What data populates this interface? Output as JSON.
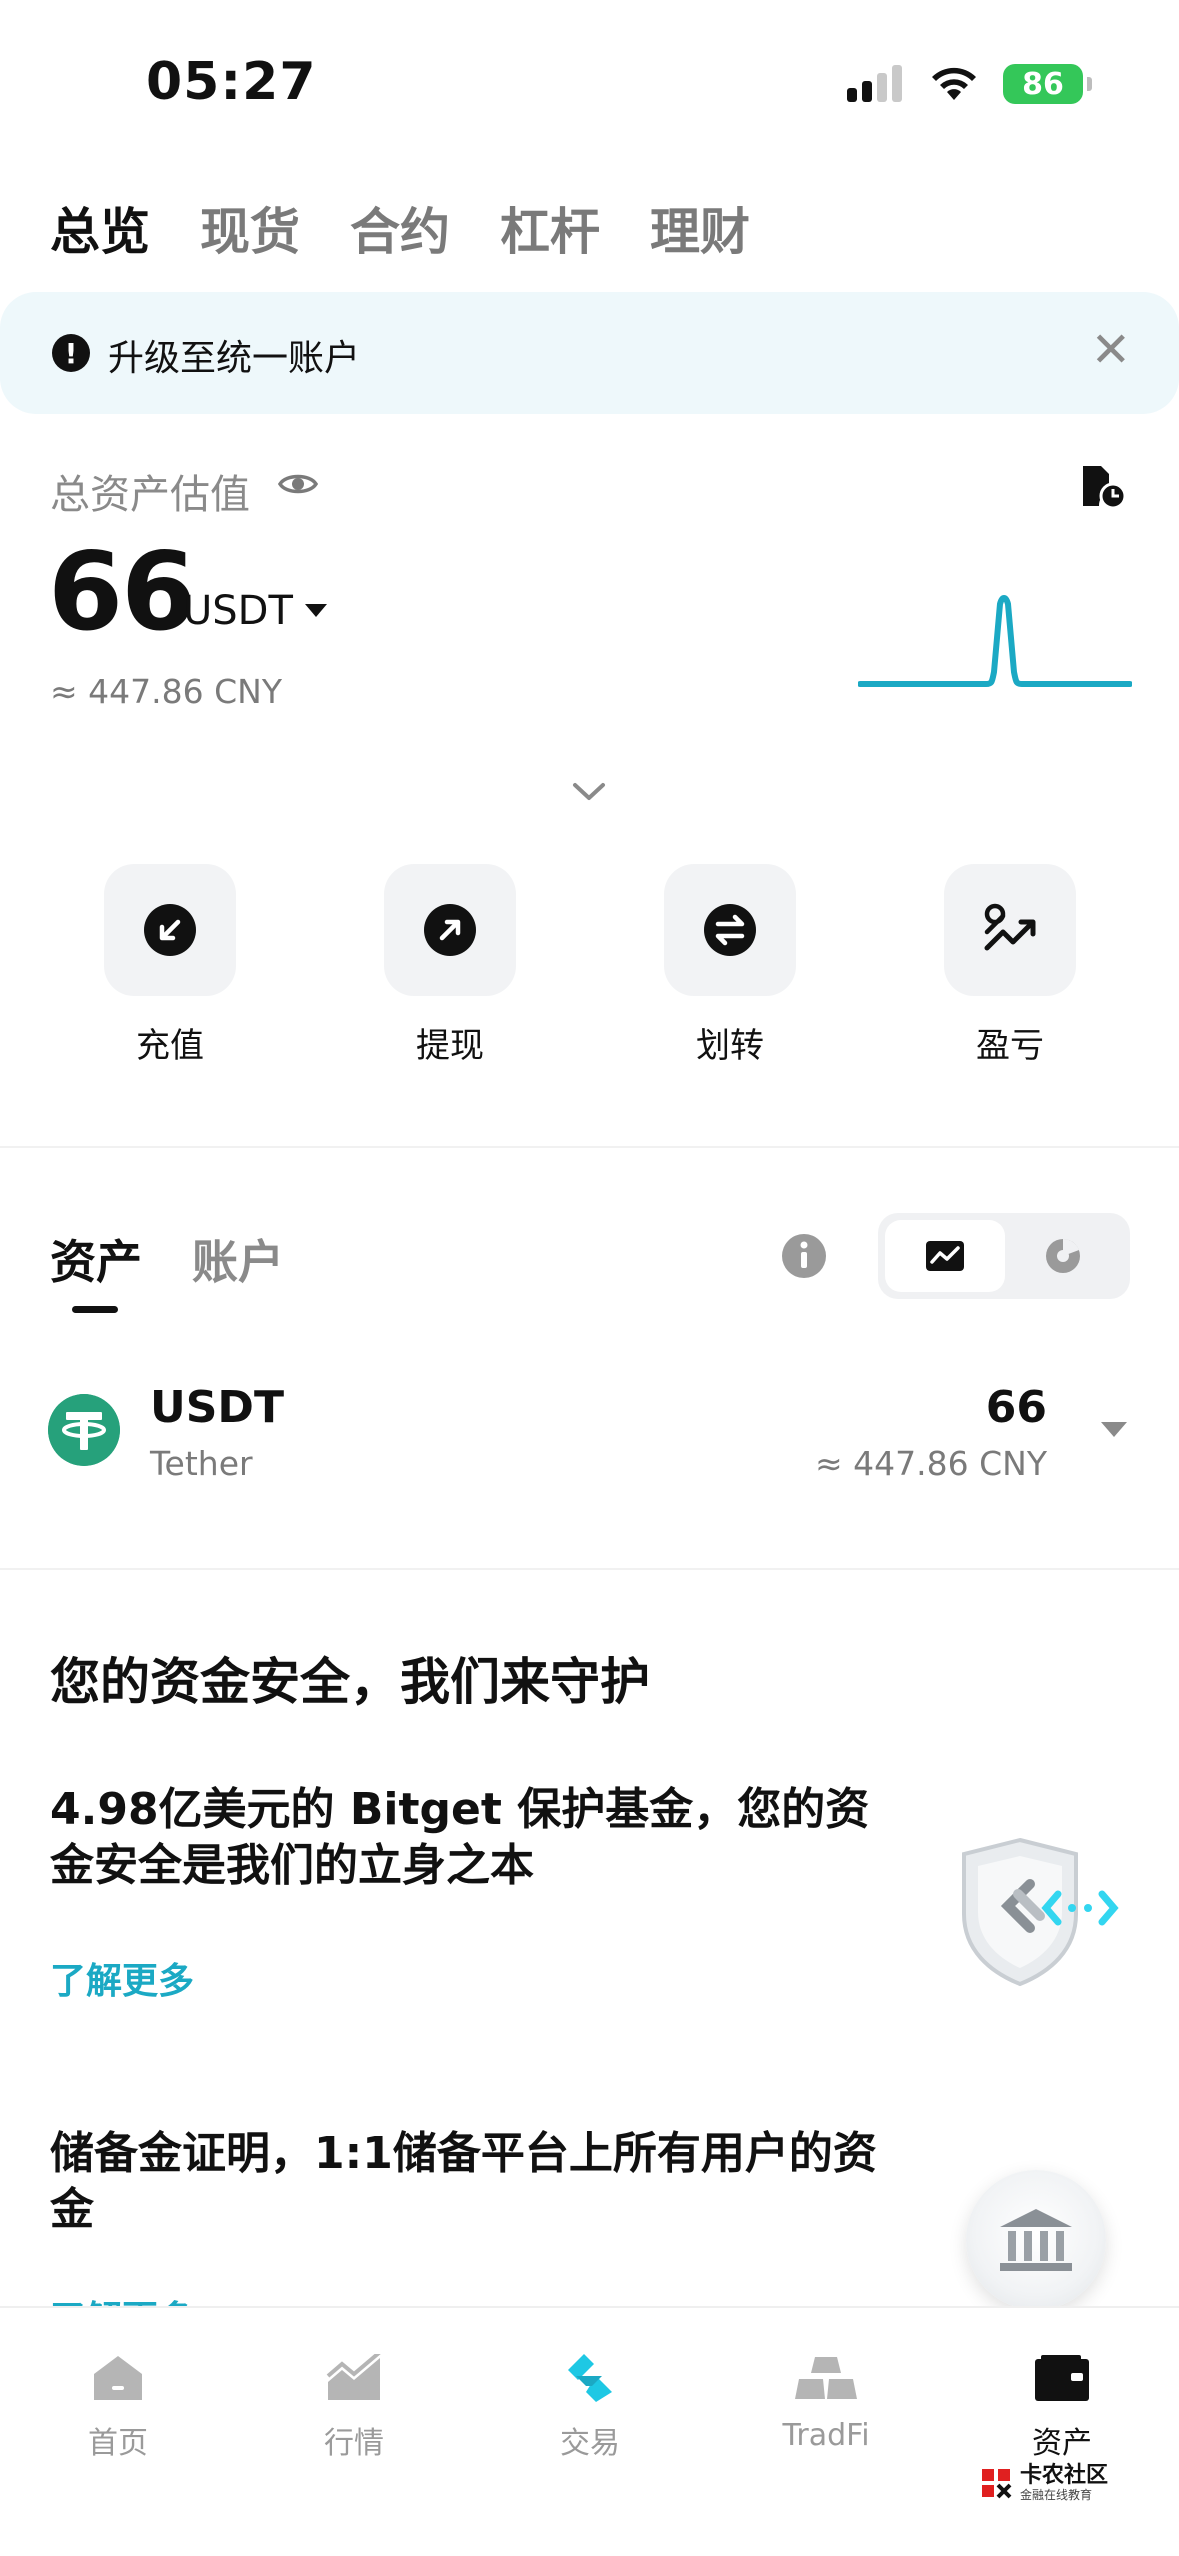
{
  "status_bar": {
    "time": "05:27",
    "battery": "86"
  },
  "top_tabs": [
    {
      "label": "总览"
    },
    {
      "label": "现货"
    },
    {
      "label": "合约"
    },
    {
      "label": "杠杆"
    },
    {
      "label": "理财"
    }
  ],
  "banner": {
    "text": "升级至统一账户",
    "icon": "!"
  },
  "overview": {
    "label": "总资产估值",
    "value": "66",
    "unit": "USDT",
    "cny": "≈ 447.86 CNY",
    "accent_color": "#1ba9c4"
  },
  "quick_actions": [
    {
      "label": "充值",
      "icon": "deposit-icon"
    },
    {
      "label": "提现",
      "icon": "withdraw-icon"
    },
    {
      "label": "划转",
      "icon": "transfer-icon"
    },
    {
      "label": "盈亏",
      "icon": "pnl-icon"
    }
  ],
  "asset_tabs": [
    {
      "label": "资产"
    },
    {
      "label": "账户"
    }
  ],
  "assets": [
    {
      "symbol": "USDT",
      "name": "Tether",
      "amount": "66",
      "cny": "≈ 447.86 CNY",
      "color": "#26a17b"
    }
  ],
  "security": {
    "title": "您的资金安全，我们来守护",
    "cards": [
      {
        "text": "4.98亿美元的 Bitget 保护基金，您的资金安全是我们的立身之本",
        "link": "了解更多"
      },
      {
        "text": "储备金证明，1:1储备平台上所有用户的资金",
        "link": "了解更多"
      }
    ]
  },
  "bottom_nav": [
    {
      "label": "首页",
      "icon": "home-icon"
    },
    {
      "label": "行情",
      "icon": "market-icon"
    },
    {
      "label": "交易",
      "icon": "trade-icon"
    },
    {
      "label": "TradFi",
      "icon": "gold-bars-icon"
    },
    {
      "label": "资产",
      "icon": "wallet-icon"
    }
  ],
  "watermark": {
    "title": "卡农社区",
    "subtitle": "金融在线教育"
  }
}
